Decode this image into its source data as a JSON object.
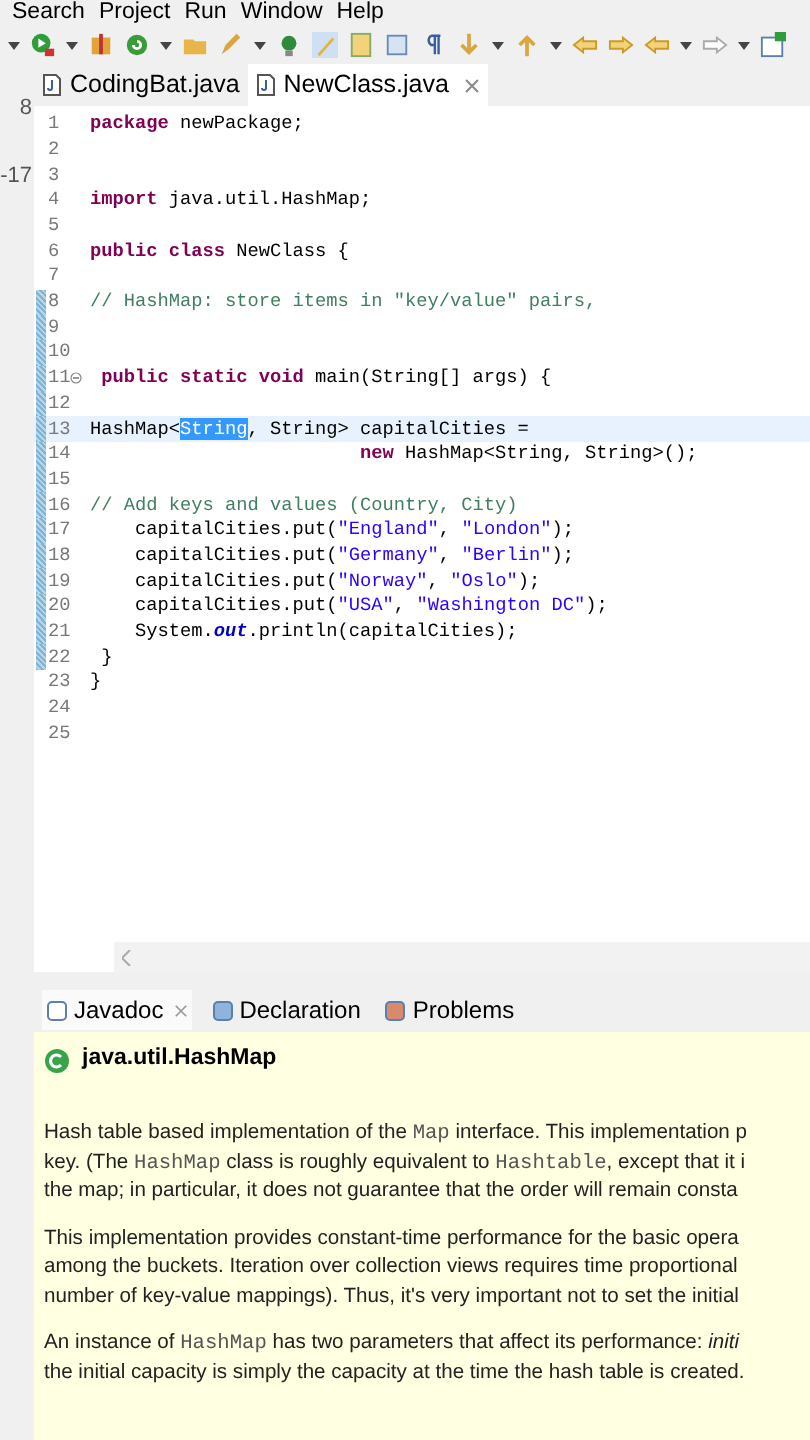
{
  "menu_bar": [
    "Search",
    "Project",
    "Run",
    "Window",
    "Help"
  ],
  "editor_tabs": [
    {
      "label": "CodingBat.java",
      "selected": false
    },
    {
      "label": "NewClass.java",
      "selected": true
    }
  ],
  "left_view_fragments": [
    "8",
    "-17"
  ],
  "code_lines": [
    {
      "number": "1",
      "changed": false,
      "segments": [
        {
          "kind": "keyword",
          "text": "package"
        },
        {
          "kind": "plain",
          "text": " newPackage;"
        }
      ]
    },
    {
      "number": "2",
      "changed": false
    },
    {
      "number": "3",
      "changed": false
    },
    {
      "number": "4",
      "changed": false,
      "segments": [
        {
          "kind": "keyword",
          "text": "import"
        },
        {
          "kind": "plain",
          "text": " java.util.HashMap;"
        }
      ]
    },
    {
      "number": "5",
      "changed": false
    },
    {
      "number": "6",
      "changed": false,
      "segments": [
        {
          "kind": "keyword",
          "text": "public class"
        },
        {
          "kind": "plain",
          "text": " NewClass {"
        }
      ]
    },
    {
      "number": "7",
      "changed": false
    },
    {
      "number": "8",
      "changed": true,
      "segments": [
        {
          "kind": "comment",
          "text": "// HashMap: store items in \"key/value\" pairs,"
        }
      ]
    },
    {
      "number": "9",
      "changed": true
    },
    {
      "number": "10",
      "changed": true
    },
    {
      "number": "11",
      "changed": true,
      "fold": true,
      "segments": [
        {
          "kind": "keyword",
          "text": " public static void"
        },
        {
          "kind": "plain",
          "text": " main(String[] args) {"
        }
      ]
    },
    {
      "number": "12",
      "changed": true
    },
    {
      "number": "13",
      "changed": true,
      "current": true,
      "segments": [
        {
          "kind": "plain",
          "text": "HashMap<"
        },
        {
          "kind": "selected",
          "text": "String"
        },
        {
          "kind": "plain",
          "text": ", String> capitalCities ="
        }
      ]
    },
    {
      "number": "14",
      "changed": true,
      "segments": [
        {
          "kind": "keyword",
          "text": "                        new"
        },
        {
          "kind": "plain",
          "text": " HashMap<String, String>();"
        }
      ]
    },
    {
      "number": "15",
      "changed": true
    },
    {
      "number": "16",
      "changed": true,
      "segments": [
        {
          "kind": "comment",
          "text": "// Add keys and values (Country, City)"
        }
      ]
    },
    {
      "number": "17",
      "changed": true,
      "segments": [
        {
          "kind": "plain",
          "text": "    capitalCities.put("
        },
        {
          "kind": "string",
          "text": "\"England\""
        },
        {
          "kind": "plain",
          "text": ", "
        },
        {
          "kind": "string",
          "text": "\"London\""
        },
        {
          "kind": "plain",
          "text": ");"
        }
      ]
    },
    {
      "number": "18",
      "changed": true,
      "segments": [
        {
          "kind": "plain",
          "text": "    capitalCities.put("
        },
        {
          "kind": "string",
          "text": "\"Germany\""
        },
        {
          "kind": "plain",
          "text": ", "
        },
        {
          "kind": "string",
          "text": "\"Berlin\""
        },
        {
          "kind": "plain",
          "text": ");"
        }
      ]
    },
    {
      "number": "19",
      "changed": true,
      "segments": [
        {
          "kind": "plain",
          "text": "    capitalCities.put("
        },
        {
          "kind": "string",
          "text": "\"Norway\""
        },
        {
          "kind": "plain",
          "text": ", "
        },
        {
          "kind": "string",
          "text": "\"Oslo\""
        },
        {
          "kind": "plain",
          "text": ");"
        }
      ]
    },
    {
      "number": "20",
      "changed": true,
      "segments": [
        {
          "kind": "plain",
          "text": "    capitalCities.put("
        },
        {
          "kind": "string",
          "text": "\"USA\""
        },
        {
          "kind": "plain",
          "text": ", "
        },
        {
          "kind": "string",
          "text": "\"Washington DC\""
        },
        {
          "kind": "plain",
          "text": ");"
        }
      ]
    },
    {
      "number": "21",
      "changed": true,
      "segments": [
        {
          "kind": "plain",
          "text": "    System."
        },
        {
          "kind": "static",
          "text": "out"
        },
        {
          "kind": "plain",
          "text": ".println(capitalCities);"
        }
      ]
    },
    {
      "number": "22",
      "changed": true,
      "segments": [
        {
          "kind": "plain",
          "text": " }"
        }
      ]
    },
    {
      "number": "23",
      "changed": false,
      "segments": [
        {
          "kind": "plain",
          "text": "}"
        }
      ]
    },
    {
      "number": "24",
      "changed": false
    },
    {
      "number": "25",
      "changed": false
    }
  ],
  "bottom_tabs": [
    {
      "label": "Javadoc",
      "selected": true
    },
    {
      "label": "Declaration",
      "selected": false
    },
    {
      "label": "Problems",
      "selected": false
    }
  ],
  "javadoc": {
    "title": "java.util.HashMap",
    "paragraphs": [
      [
        [
          {
            "kind": "text",
            "text": "Hash table based implementation of the "
          },
          {
            "kind": "code",
            "text": "Map"
          },
          {
            "kind": "text",
            "text": " interface. This implementation p"
          }
        ],
        [
          {
            "kind": "text",
            "text": "key. (The "
          },
          {
            "kind": "code",
            "text": "HashMap"
          },
          {
            "kind": "text",
            "text": " class is roughly equivalent to "
          },
          {
            "kind": "code",
            "text": "Hashtable"
          },
          {
            "kind": "text",
            "text": ", except that it i"
          }
        ],
        [
          {
            "kind": "text",
            "text": "the map; in particular, it does not guarantee that the order will remain consta"
          }
        ]
      ],
      [
        [
          {
            "kind": "text",
            "text": "This implementation provides constant-time performance for the basic opera"
          }
        ],
        [
          {
            "kind": "text",
            "text": "among the buckets. Iteration over collection views requires time proportional"
          }
        ],
        [
          {
            "kind": "text",
            "text": "number of key-value mappings). Thus, it's very important not to set the initial"
          }
        ]
      ],
      [
        [
          {
            "kind": "text",
            "text": "An instance of "
          },
          {
            "kind": "code",
            "text": "HashMap"
          },
          {
            "kind": "text",
            "text": " has two parameters that affect its performance: "
          },
          {
            "kind": "italic",
            "text": "initi"
          }
        ],
        [
          {
            "kind": "text",
            "text": "the initial capacity is simply the capacity at the time the hash table is created."
          }
        ]
      ]
    ]
  }
}
